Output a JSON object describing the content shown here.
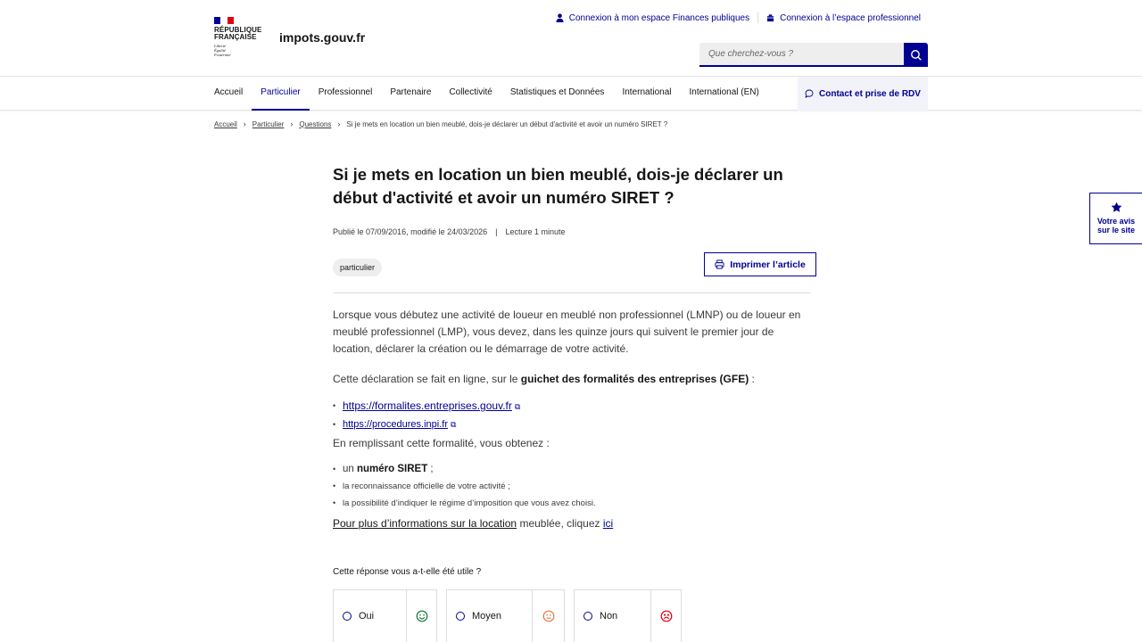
{
  "header": {
    "republic_line1": "RÉPUBLIQUE",
    "republic_line2": "FRANÇAISE",
    "motto_1": "Liberté",
    "motto_2": "Égalité",
    "motto_3": "Fraternité",
    "site_name": "impots.gouv.fr",
    "top_links": [
      {
        "label": "Connexion à mon espace Finances publiques",
        "icon": "user-icon"
      },
      {
        "label": "Connexion à l’espace professionnel",
        "icon": "building-icon"
      }
    ],
    "search_placeholder": "Que cherchez-vous ?",
    "colors": {
      "primary": "#000091",
      "flag_red": "#e1000f"
    }
  },
  "nav": {
    "items": [
      {
        "label": "Accueil",
        "active": false
      },
      {
        "label": "Particulier",
        "active": true
      },
      {
        "label": "Professionnel",
        "active": false
      },
      {
        "label": "Partenaire",
        "active": false
      },
      {
        "label": "Collectivité",
        "active": false
      },
      {
        "label": "Statistiques et Données",
        "active": false
      },
      {
        "label": "International",
        "active": false
      },
      {
        "label": "International (EN)",
        "active": false
      }
    ],
    "contact_label": "Contact et prise de RDV"
  },
  "breadcrumb": {
    "items": [
      "Accueil",
      "Particulier",
      "Questions"
    ],
    "current": "Si je mets en location un bien meublé, dois-je déclarer un début d'activité et avoir un numéro SIRET ?"
  },
  "article": {
    "title": "Si je mets en location un bien meublé, dois-je déclarer un début d'activité et avoir un numéro SIRET ?",
    "published": "Publié le 07/09/2016, modifié le 24/03/2026",
    "reading_time": "Lecture 1 minute",
    "tag": "particulier",
    "print_label": "Imprimer l’article",
    "para1": "Lorsque vous débutez une activité de loueur en meublé non professionnel (LMNP) ou de loueur en meublé professionnel (LMP), vous devez, dans les quinze jours qui suivent le premier jour de location, déclarer la création ou le démarrage de votre activité.",
    "para2_prefix": "Cette déclaration se fait en ligne, sur le ",
    "para2_bold": "guichet des formalités des entreprises (GFE)",
    "para2_suffix": " :",
    "links": [
      "https://formalites.entreprises.gouv.fr",
      "https://procedures.inpi.fr"
    ],
    "para3": "En remplissant cette formalité, vous obtenez :",
    "list_item1_prefix": "un ",
    "list_item1_bold": "numéro SIRET",
    "list_item1_suffix": " ;",
    "list_item2": "la reconnaissance officielle de votre activité ;",
    "list_item3": "la possibilité d’indiquer le régime d’imposition que vous avez choisi.",
    "more_link": "Pour plus d’informations sur la location",
    "more_mid": " meublée, cliquez ",
    "more_ici": "ici"
  },
  "feedback": {
    "question": "Cette réponse vous a-t-elle été utile ?",
    "options": [
      {
        "label": "Oui",
        "icon": "smile-icon",
        "color": "#18753c"
      },
      {
        "label": "Moyen",
        "icon": "neutral-face-icon",
        "color": "#e4794a"
      },
      {
        "label": "Non",
        "icon": "sad-face-icon",
        "color": "#e1000f"
      }
    ]
  },
  "side_widget": {
    "line1": "Votre avis",
    "line2": "sur le site",
    "icon": "star-icon"
  }
}
